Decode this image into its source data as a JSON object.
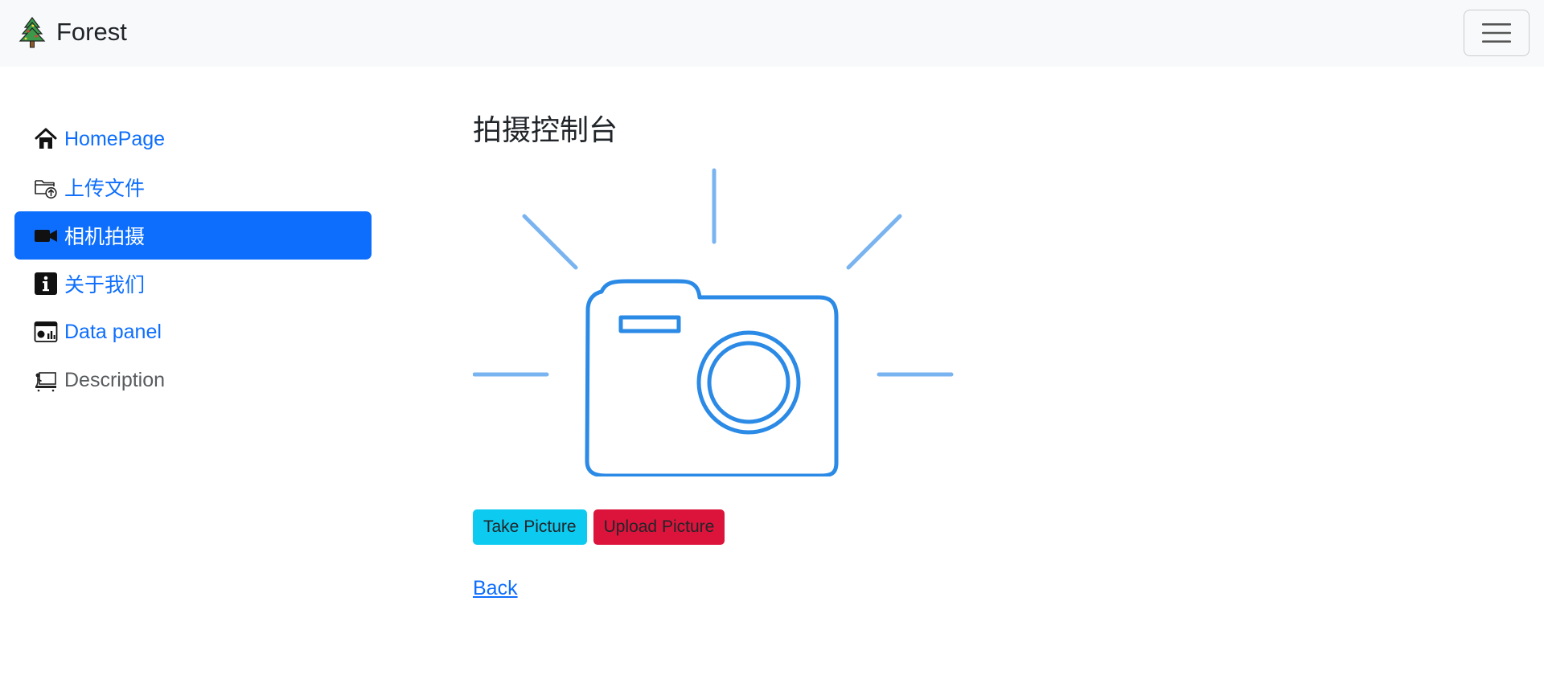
{
  "navbar": {
    "brand_name": "Forest",
    "brand_icon": "tree-icon",
    "toggler_icon": "hamburger-menu-icon"
  },
  "sidebar": {
    "items": [
      {
        "label": "HomePage",
        "icon": "house-icon"
      },
      {
        "label": "上传文件",
        "icon": "folder-upload-icon"
      },
      {
        "label": "相机拍摄",
        "icon": "video-camera-icon",
        "active": true
      },
      {
        "label": "关于我们",
        "icon": "info-icon"
      },
      {
        "label": "Data panel",
        "icon": "dashboard-window-icon"
      },
      {
        "label": "Description",
        "icon": "projector-icon"
      }
    ]
  },
  "main": {
    "title": "拍摄控制台",
    "illustration": "camera-flash-icon",
    "take_picture_label": "Take Picture",
    "upload_picture_label": "Upload Picture",
    "back_label": "Back"
  },
  "colors": {
    "primary": "#0d6efd",
    "info": "#0dcaf0",
    "danger": "#dc143c",
    "navbar_bg": "#f8f9fa",
    "camera_stroke": "#2b8ae6",
    "camera_rays": "#7ab4f0"
  }
}
